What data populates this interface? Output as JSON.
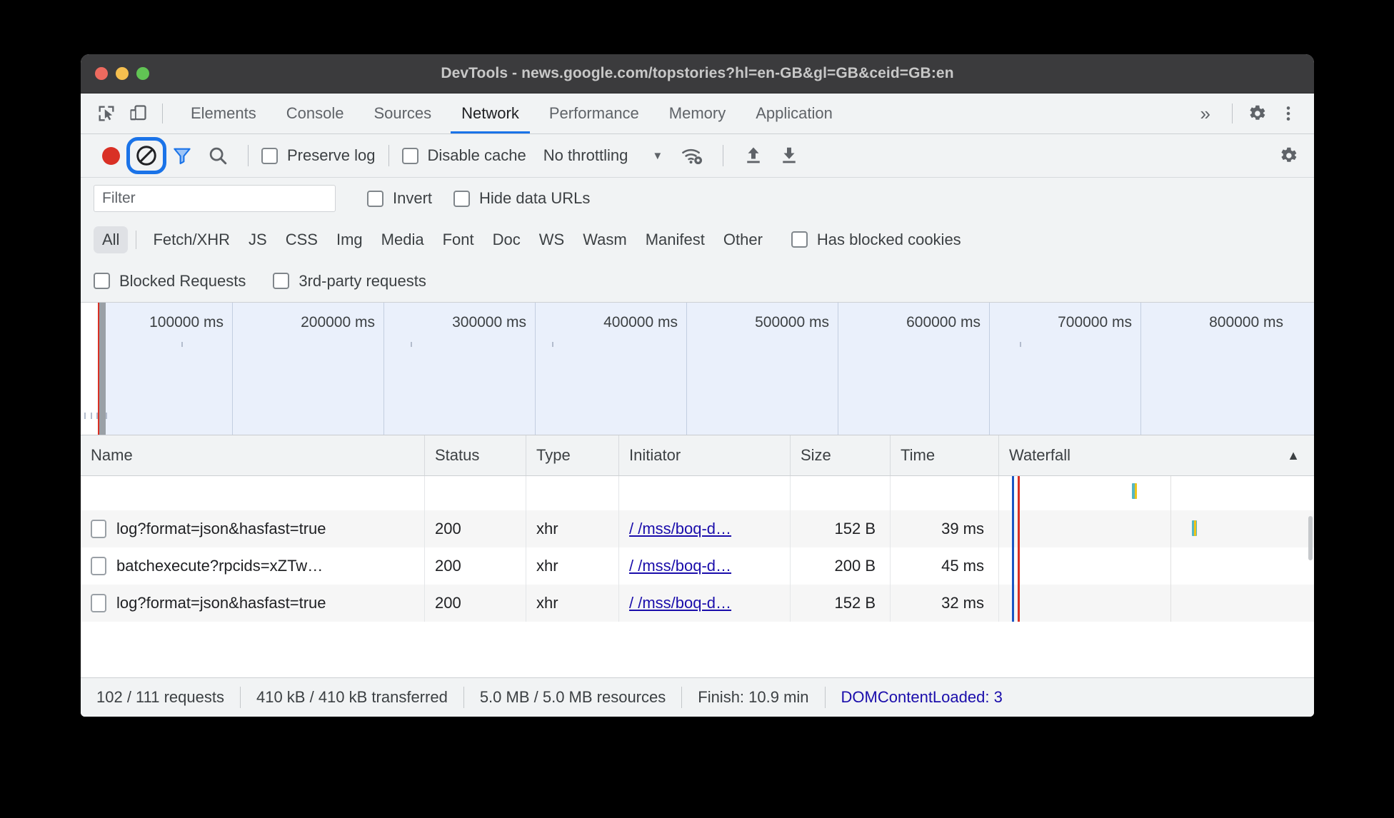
{
  "window": {
    "title": "DevTools - news.google.com/topstories?hl=en-GB&gl=GB&ceid=GB:en"
  },
  "tabstrip": {
    "icons": [
      "inspect-icon",
      "device-toolbar-icon"
    ],
    "tabs": [
      {
        "label": "Elements",
        "active": false
      },
      {
        "label": "Console",
        "active": false
      },
      {
        "label": "Sources",
        "active": false
      },
      {
        "label": "Network",
        "active": true
      },
      {
        "label": "Performance",
        "active": false
      },
      {
        "label": "Memory",
        "active": false
      },
      {
        "label": "Application",
        "active": false
      }
    ],
    "more_label": "»",
    "settings_icon": "gear-icon",
    "menu_icon": "kebab-menu-icon"
  },
  "network_toolbar": {
    "record_title": "record-button",
    "clear_title": "clear-button",
    "filter_title": "filter-toggle",
    "search_title": "search-button",
    "preserve_log_label": "Preserve log",
    "preserve_log_checked": false,
    "disable_cache_label": "Disable cache",
    "disable_cache_checked": false,
    "throttling_value": "No throttling",
    "throttling_caret": "▼",
    "wifi_icon": "network-conditions-icon",
    "import_icon": "import-har-icon",
    "export_icon": "export-har-icon",
    "settings_icon": "network-settings-gear-icon"
  },
  "filter_row": {
    "filter_placeholder": "Filter",
    "filter_value": "",
    "invert_label": "Invert",
    "invert_checked": false,
    "hide_data_urls_label": "Hide data URLs",
    "hide_data_urls_checked": false
  },
  "type_filters": {
    "chips": [
      {
        "label": "All",
        "selected": true
      },
      {
        "label": "Fetch/XHR",
        "selected": false
      },
      {
        "label": "JS",
        "selected": false
      },
      {
        "label": "CSS",
        "selected": false
      },
      {
        "label": "Img",
        "selected": false
      },
      {
        "label": "Media",
        "selected": false
      },
      {
        "label": "Font",
        "selected": false
      },
      {
        "label": "Doc",
        "selected": false
      },
      {
        "label": "WS",
        "selected": false
      },
      {
        "label": "Wasm",
        "selected": false
      },
      {
        "label": "Manifest",
        "selected": false
      },
      {
        "label": "Other",
        "selected": false
      }
    ],
    "has_blocked_cookies_label": "Has blocked cookies",
    "has_blocked_cookies_checked": false,
    "blocked_requests_label": "Blocked Requests",
    "blocked_requests_checked": false,
    "third_party_label": "3rd-party requests",
    "third_party_checked": false
  },
  "overview": {
    "ticks": [
      "100000 ms",
      "200000 ms",
      "300000 ms",
      "400000 ms",
      "500000 ms",
      "600000 ms",
      "700000 ms",
      "800000 ms"
    ]
  },
  "grid": {
    "columns": [
      {
        "key": "name",
        "label": "Name"
      },
      {
        "key": "status",
        "label": "Status"
      },
      {
        "key": "type",
        "label": "Type"
      },
      {
        "key": "initiator",
        "label": "Initiator"
      },
      {
        "key": "size",
        "label": "Size"
      },
      {
        "key": "time",
        "label": "Time"
      },
      {
        "key": "waterfall",
        "label": "Waterfall"
      }
    ],
    "sort_indicator": "▲",
    "rows": [
      {
        "name": "log?format=json&hasfast=true",
        "status": "200",
        "type": "xhr",
        "initiator": "/  /mss/boq-d…",
        "size": "152 B",
        "time": "39 ms"
      },
      {
        "name": "batchexecute?rpcids=xZTw…",
        "status": "200",
        "type": "xhr",
        "initiator": "/  /mss/boq-d…",
        "size": "200 B",
        "time": "45 ms"
      },
      {
        "name": "log?format=json&hasfast=true",
        "status": "200",
        "type": "xhr",
        "initiator": "/  /mss/boq-d…",
        "size": "152 B",
        "time": "32 ms"
      }
    ]
  },
  "statusbar": {
    "requests": "102 / 111 requests",
    "transferred": "410 kB / 410 kB transferred",
    "resources": "5.0 MB / 5.0 MB resources",
    "finish": "Finish: 10.9 min",
    "domcontentloaded": "DOMContentLoaded: 3"
  },
  "colors": {
    "accent": "#1a73e8",
    "record": "#d93025",
    "link": "#1a0dab",
    "toolbar_bg": "#f1f3f4",
    "overview_bg": "#eaf0fb"
  }
}
